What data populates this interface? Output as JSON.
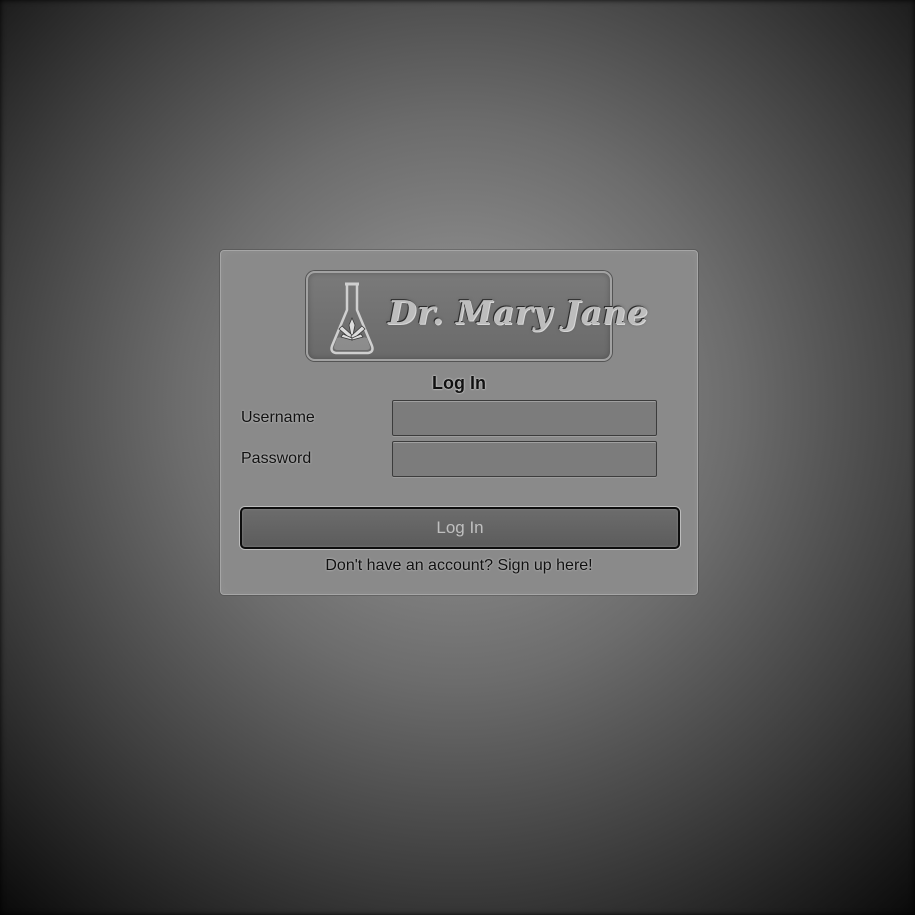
{
  "logo": {
    "text": "Dr. Mary Jane",
    "icon": "flask-leaf-icon"
  },
  "form": {
    "title": "Log In",
    "username_label": "Username",
    "username_value": "",
    "password_label": "Password",
    "password_value": "",
    "submit_label": "Log In",
    "signup_link": "Don't have an account? Sign up here!"
  },
  "colors": {
    "background_center": "#9a9a9a",
    "background_edge": "#060606",
    "card": "#8a8a8a",
    "button": "#5c5c5c"
  }
}
